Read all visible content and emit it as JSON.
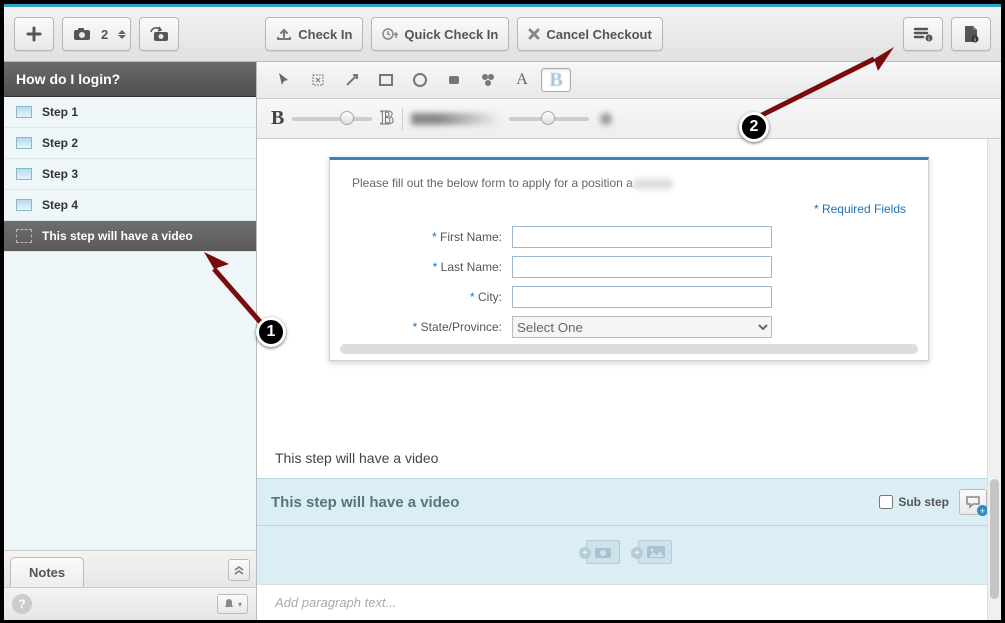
{
  "toolbar": {
    "screenshot_count": "2",
    "check_in": "Check In",
    "quick_check_in": "Quick Check In",
    "cancel_checkout": "Cancel Checkout"
  },
  "lesson": {
    "title": "How do I login?"
  },
  "steps": [
    {
      "label": "Step 1"
    },
    {
      "label": "Step 2"
    },
    {
      "label": "Step 3"
    },
    {
      "label": "Step 4"
    },
    {
      "label": "This step will have a video"
    }
  ],
  "sidebar": {
    "notes_tab": "Notes"
  },
  "annotation_tools": {
    "border_letter": "B",
    "text_letter": "A"
  },
  "form": {
    "description_prefix": "Please fill out the below form to apply for a position a",
    "required_note": "* Required Fields",
    "first_name_label": "First Name:",
    "last_name_label": "Last Name:",
    "city_label": "City:",
    "state_label": "State/Province:",
    "asterisk": "*",
    "state_placeholder": "Select One"
  },
  "current_step": {
    "caption": "This step will have a video",
    "header": "This step will have a video",
    "substep_label": "Sub step",
    "paragraph_placeholder": "Add paragraph text..."
  },
  "callouts": {
    "one": "1",
    "two": "2"
  }
}
